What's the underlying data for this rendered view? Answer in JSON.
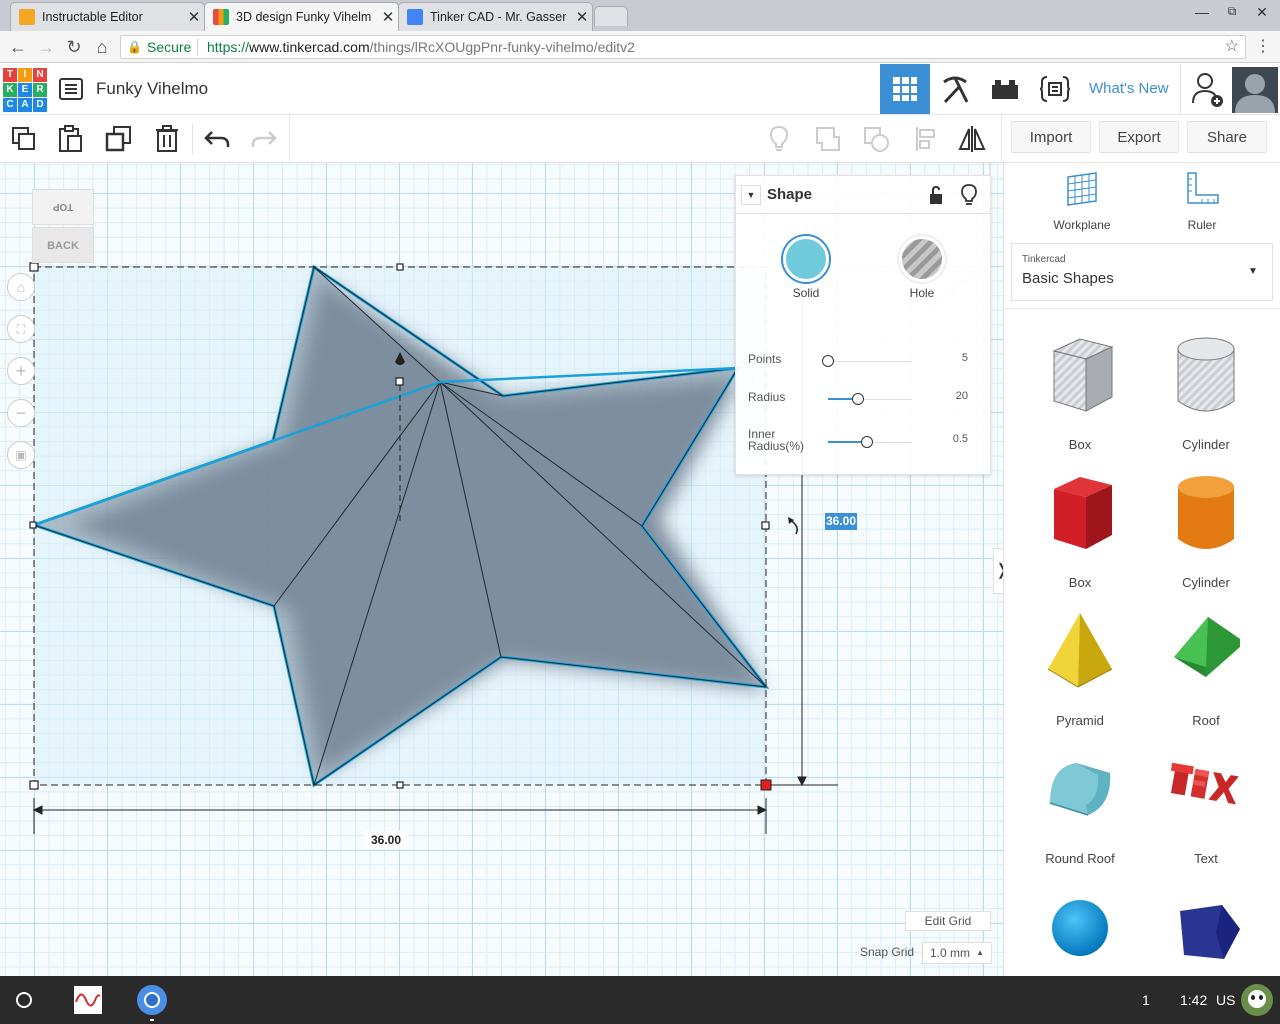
{
  "browser": {
    "tabs": [
      {
        "title": "Instructable Editor",
        "active": false,
        "favicon_color": "#f5a623"
      },
      {
        "title": "3D design Funky Vihelm",
        "active": true,
        "favicon_color": "#ea4335"
      },
      {
        "title": "Tinker CAD - Mr. Gasser",
        "active": false,
        "favicon_color": "#4285f4"
      }
    ],
    "secure_label": "Secure",
    "url_scheme": "https://",
    "url_host": "www.tinkercad.com",
    "url_path": "/things/lRcXOUgpPnr-funky-vihelmo/editv2"
  },
  "app": {
    "logo_letters": [
      "T",
      "I",
      "N",
      "K",
      "E",
      "R",
      "C",
      "A",
      "D"
    ],
    "design_title": "Funky Vihelmo",
    "whats_new": "What's New",
    "actions": {
      "import": "Import",
      "export": "Export",
      "share": "Share"
    }
  },
  "viewcube": {
    "top": "TOP",
    "back": "BACK"
  },
  "shape_panel": {
    "title": "Shape",
    "solid": "Solid",
    "hole": "Hole",
    "params": [
      {
        "label": "Points",
        "value": "5",
        "fraction": 0.0
      },
      {
        "label": "Radius",
        "value": "20",
        "fraction": 0.36
      },
      {
        "label": "Inner Radius(%)",
        "value": "0.5",
        "fraction": 0.47
      }
    ]
  },
  "dimensions": {
    "width": "36.00",
    "depth": "36.00"
  },
  "grid": {
    "edit_grid": "Edit Grid",
    "snap_label": "Snap Grid",
    "snap_value": "1.0 mm"
  },
  "right_panel": {
    "workplane": "Workplane",
    "ruler": "Ruler",
    "library_provider": "Tinkercad",
    "library_name": "Basic Shapes",
    "shapes": [
      {
        "name": "Box",
        "icon": "box-striped-icon"
      },
      {
        "name": "Cylinder",
        "icon": "cylinder-striped-icon"
      },
      {
        "name": "Box",
        "icon": "box-red-icon"
      },
      {
        "name": "Cylinder",
        "icon": "cylinder-orange-icon"
      },
      {
        "name": "Pyramid",
        "icon": "pyramid-icon"
      },
      {
        "name": "Roof",
        "icon": "roof-icon"
      },
      {
        "name": "Round Roof",
        "icon": "round-roof-icon"
      },
      {
        "name": "Text",
        "icon": "text-icon"
      },
      {
        "name": "",
        "icon": "sphere-icon"
      },
      {
        "name": "",
        "icon": "polygon-icon"
      }
    ]
  },
  "taskbar": {
    "page_num": "1",
    "time": "1:42",
    "locale": "US"
  },
  "colors": {
    "accent": "#3b8fd5",
    "selection": "#1aa2d8",
    "star_fill": "#7a8d9e"
  }
}
